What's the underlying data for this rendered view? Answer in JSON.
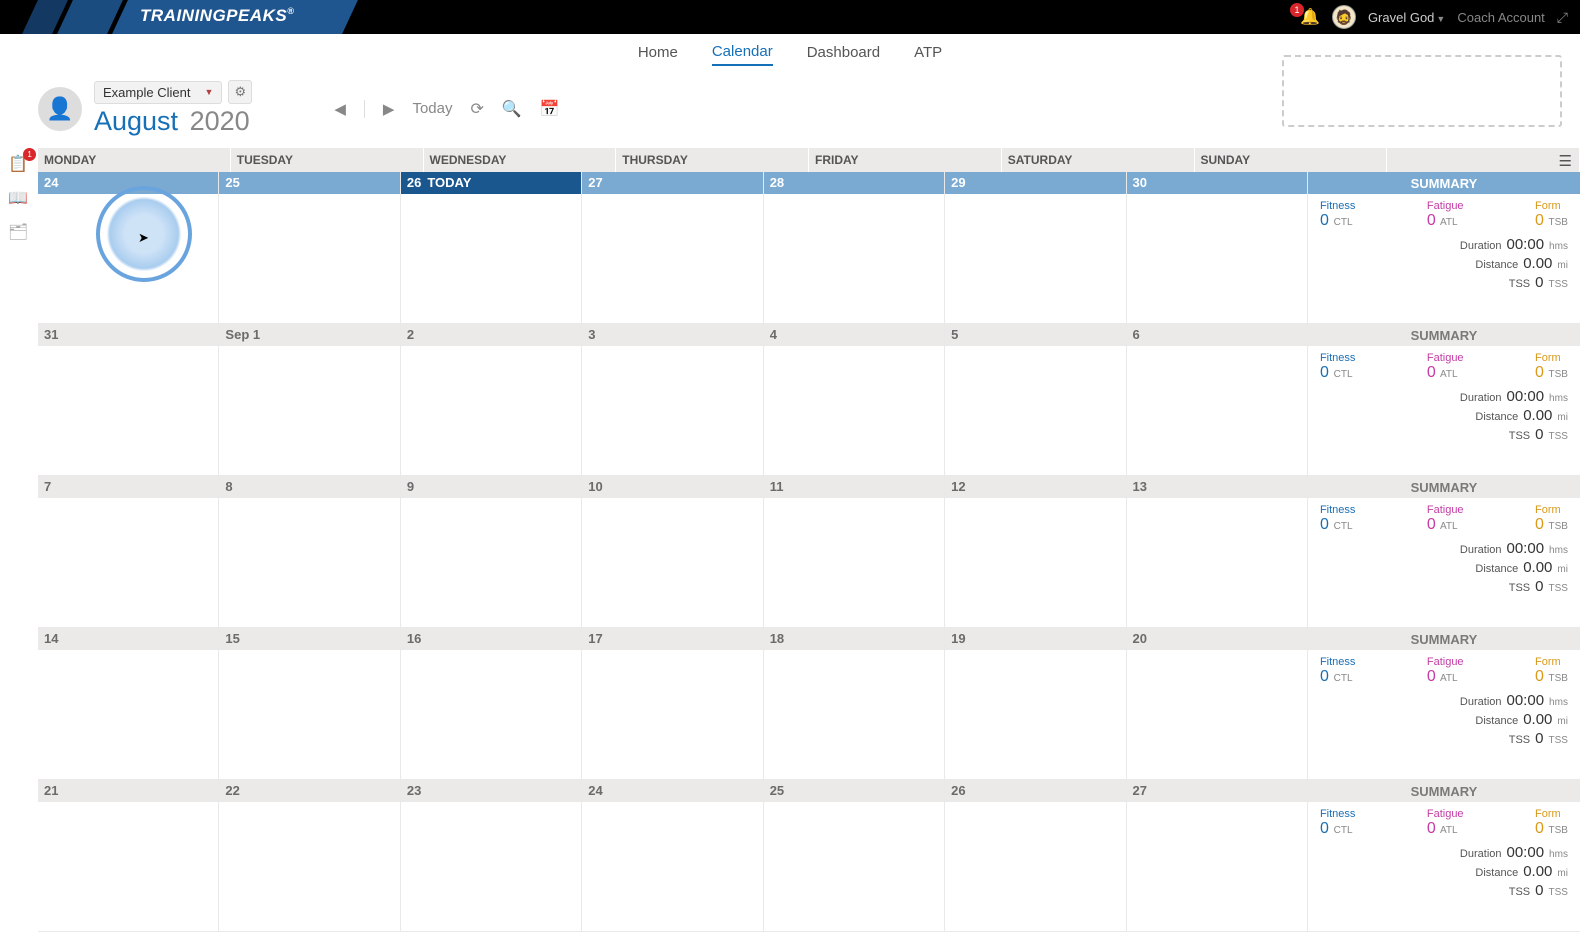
{
  "brand": "TRAININGPEAKS",
  "topbar": {
    "notifications_count": "1",
    "user_name": "Gravel God",
    "account_link": "Coach Account"
  },
  "nav": {
    "home": "Home",
    "calendar": "Calendar",
    "dashboard": "Dashboard",
    "atp": "ATP"
  },
  "client": {
    "selected": "Example Client"
  },
  "period": {
    "month": "August",
    "year": "2020",
    "today_btn": "Today"
  },
  "left_rail": {
    "badge": "1"
  },
  "day_headers": [
    "MONDAY",
    "TUESDAY",
    "WEDNESDAY",
    "THURSDAY",
    "FRIDAY",
    "SATURDAY",
    "SUNDAY"
  ],
  "today_label": "TODAY",
  "weeks": [
    {
      "current": true,
      "today_index": 2,
      "dates": [
        "24",
        "25",
        "26",
        "27",
        "28",
        "29",
        "30"
      ]
    },
    {
      "dates": [
        "31",
        "Sep 1",
        "2",
        "3",
        "4",
        "5",
        "6"
      ]
    },
    {
      "dates": [
        "7",
        "8",
        "9",
        "10",
        "11",
        "12",
        "13"
      ]
    },
    {
      "dates": [
        "14",
        "15",
        "16",
        "17",
        "18",
        "19",
        "20"
      ]
    },
    {
      "dates": [
        "21",
        "22",
        "23",
        "24",
        "25",
        "26",
        "27"
      ]
    }
  ],
  "summary": {
    "title": "SUMMARY",
    "fitness_label": "Fitness",
    "fitness_val": "0",
    "fitness_unit": "CTL",
    "fatigue_label": "Fatigue",
    "fatigue_val": "0",
    "fatigue_unit": "ATL",
    "form_label": "Form",
    "form_val": "0",
    "form_unit": "TSB",
    "duration_label": "Duration",
    "duration_val": "00:00",
    "duration_unit": "hms",
    "distance_label": "Distance",
    "distance_val": "0.00",
    "distance_unit": "mi",
    "tss_label": "TSS",
    "tss_val": "0",
    "tss_unit": "TSS"
  }
}
